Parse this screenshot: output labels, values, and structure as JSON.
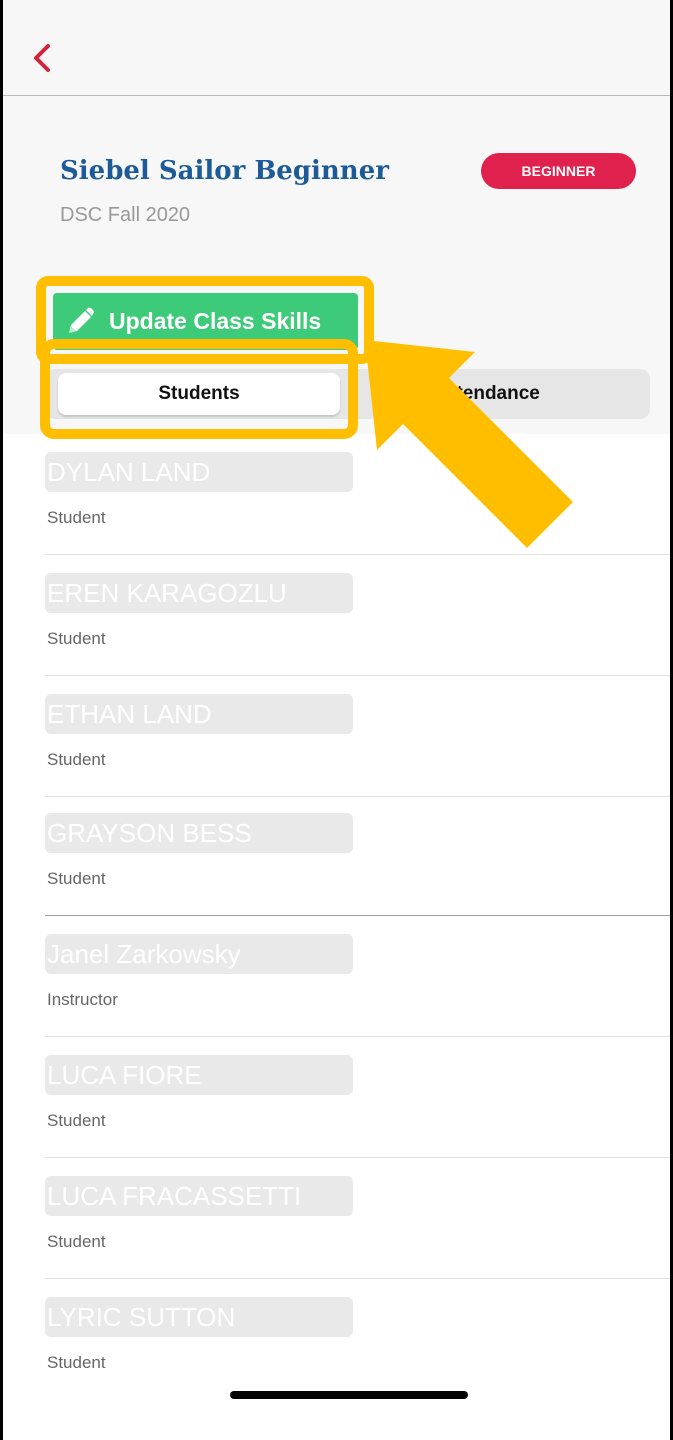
{
  "nav": {
    "back_icon": "chevron-left-icon",
    "accent": "#d0243a"
  },
  "class_info": {
    "title": "Siebel Sailor Beginner",
    "subtitle": "DSC Fall 2020",
    "level_badge": "BEGINNER",
    "badge_color": "#e0204d",
    "title_color": "#1c5b97"
  },
  "actions": {
    "update_label": "Update Class Skills",
    "update_icon": "pencil-icon",
    "button_color": "#3ecb79"
  },
  "tabs": [
    {
      "label": "Students",
      "selected": true
    },
    {
      "label": "ttendance",
      "selected": false
    }
  ],
  "roster": [
    {
      "name": "DYLAN LAND",
      "role": "Student"
    },
    {
      "name": "EREN KARAGOZLU",
      "role": "Student"
    },
    {
      "name": "ETHAN LAND",
      "role": "Student"
    },
    {
      "name": "GRAYSON BESS",
      "role": "Student"
    },
    {
      "name": "Janel Zarkowsky",
      "role": "Instructor"
    },
    {
      "name": "LUCA FIORE",
      "role": "Student"
    },
    {
      "name": "LUCA FRACASSETTI",
      "role": "Student"
    },
    {
      "name": "LYRIC SUTTON",
      "role": "Student"
    }
  ],
  "annotation": {
    "highlight_color": "#ffbf00",
    "arrow_icon": "pointer-arrow-icon"
  }
}
